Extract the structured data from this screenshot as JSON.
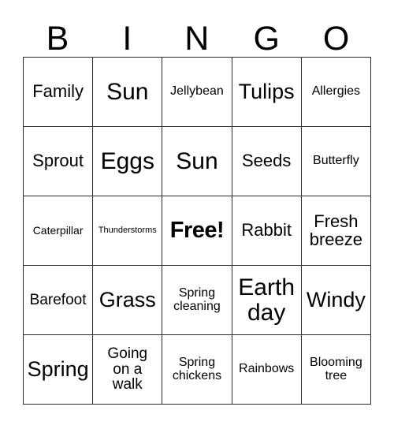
{
  "card": {
    "headers": [
      "B",
      "I",
      "N",
      "G",
      "O"
    ],
    "rows": [
      [
        {
          "text": "Family",
          "size": "fs-l"
        },
        {
          "text": "Sun",
          "size": "fs-xxl"
        },
        {
          "text": "Jellybean",
          "size": "fs-s"
        },
        {
          "text": "Tulips",
          "size": "fs-xl"
        },
        {
          "text": "Allergies",
          "size": "fs-s"
        }
      ],
      [
        {
          "text": "Sprout",
          "size": "fs-l"
        },
        {
          "text": "Eggs",
          "size": "fs-xxl"
        },
        {
          "text": "Sun",
          "size": "fs-xxl"
        },
        {
          "text": "Seeds",
          "size": "fs-l"
        },
        {
          "text": "Butterfly",
          "size": "fs-s"
        }
      ],
      [
        {
          "text": "Caterpillar",
          "size": "fs-xs"
        },
        {
          "text": "Thunderstorms",
          "size": "fs-xxs"
        },
        {
          "text": "Free!",
          "size": "free"
        },
        {
          "text": "Rabbit",
          "size": "fs-l"
        },
        {
          "text": "Fresh\nbreeze",
          "size": "fs-l"
        }
      ],
      [
        {
          "text": "Barefoot",
          "size": "fs-m"
        },
        {
          "text": "Grass",
          "size": "fs-xl"
        },
        {
          "text": "Spring\ncleaning",
          "size": "fs-s"
        },
        {
          "text": "Earth\nday",
          "size": "fs-xxl"
        },
        {
          "text": "Windy",
          "size": "fs-xl"
        }
      ],
      [
        {
          "text": "Spring",
          "size": "fs-xl"
        },
        {
          "text": "Going\non a\nwalk",
          "size": "fs-m"
        },
        {
          "text": "Spring\nchickens",
          "size": "fs-s"
        },
        {
          "text": "Rainbows",
          "size": "fs-s"
        },
        {
          "text": "Blooming\ntree",
          "size": "fs-s"
        }
      ]
    ]
  }
}
